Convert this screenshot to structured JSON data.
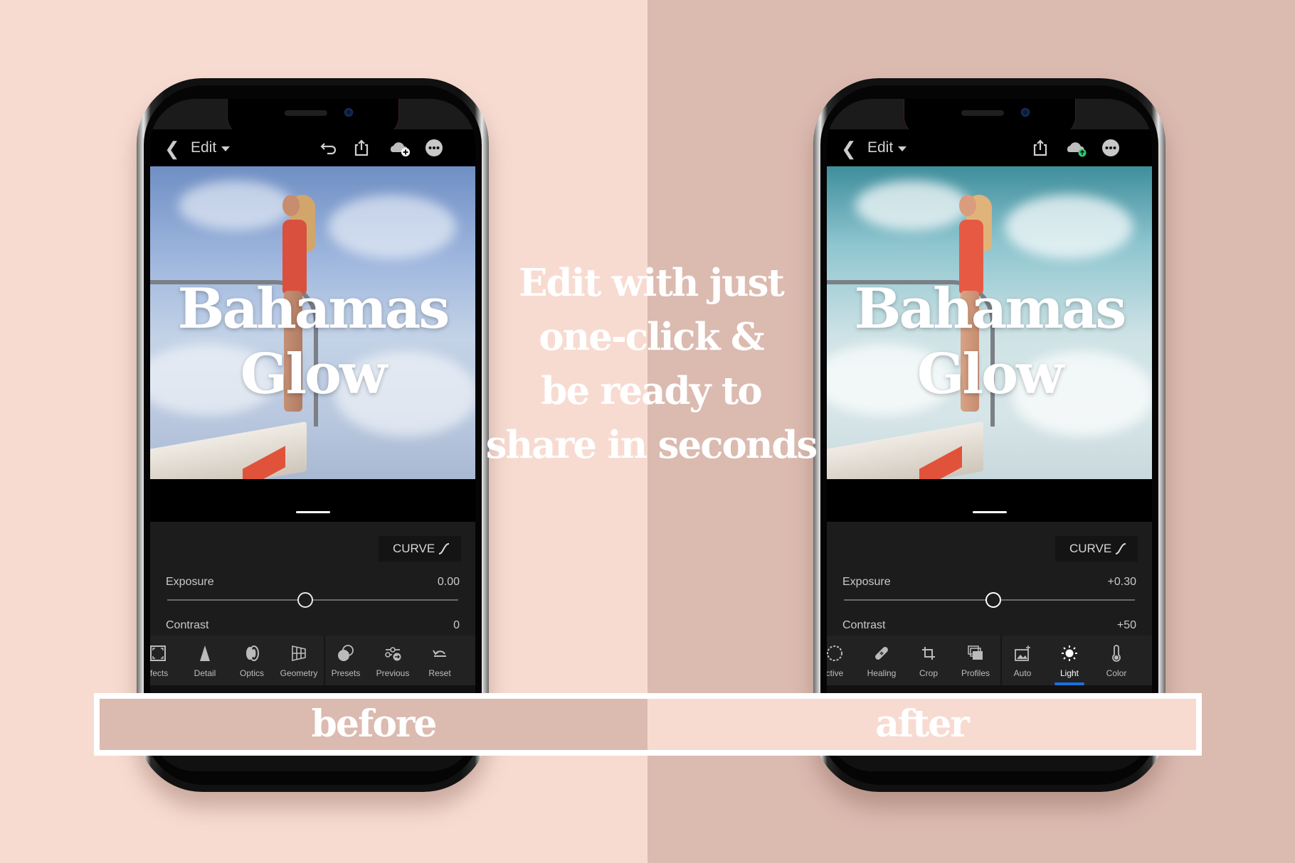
{
  "background": {
    "left_color": "#F7DBD1",
    "right_color": "#DBBAB0"
  },
  "headline": {
    "lines": [
      "Edit with just",
      "one-click &",
      "be ready to",
      "share in seconds"
    ]
  },
  "banner": {
    "before_label": "before",
    "after_label": "after"
  },
  "phones": {
    "before": {
      "topbar": {
        "title": "Edit",
        "icons": [
          "chevron-left-icon",
          "undo-icon",
          "share-icon",
          "cloud-add-icon",
          "more-icon"
        ]
      },
      "photo_title": [
        "Bahamas",
        "Glow"
      ],
      "curve_label": "CURVE",
      "sliders": [
        {
          "label": "Exposure",
          "value": "0.00",
          "position": 0.5
        },
        {
          "label": "Contrast",
          "value": "0"
        }
      ],
      "toolbar": [
        {
          "label": "ffects",
          "icon": "vignette-icon"
        },
        {
          "label": "Detail",
          "icon": "triangle-icon"
        },
        {
          "label": "Optics",
          "icon": "lens-icon"
        },
        {
          "label": "Geometry",
          "icon": "grid-perspective-icon"
        },
        {
          "label": "Presets",
          "icon": "presets-icon"
        },
        {
          "label": "Previous",
          "icon": "previous-icon"
        },
        {
          "label": "Reset",
          "icon": "reset-icon"
        }
      ]
    },
    "after": {
      "topbar": {
        "title": "Edit",
        "icons": [
          "chevron-left-icon",
          "share-icon",
          "cloud-synced-icon",
          "more-icon"
        ]
      },
      "photo_title": [
        "Bahamas",
        "Glow"
      ],
      "curve_label": "CURVE",
      "sliders": [
        {
          "label": "Exposure",
          "value": "+0.30",
          "position": 0.53
        },
        {
          "label": "Contrast",
          "value": "+50"
        }
      ],
      "toolbar": [
        {
          "label": "ctive",
          "icon": "selective-icon"
        },
        {
          "label": "Healing",
          "icon": "bandage-icon"
        },
        {
          "label": "Crop",
          "icon": "crop-icon"
        },
        {
          "label": "Profiles",
          "icon": "profiles-icon"
        },
        {
          "label": "Auto",
          "icon": "auto-icon"
        },
        {
          "label": "Light",
          "icon": "sun-icon",
          "active": true
        },
        {
          "label": "Color",
          "icon": "thermometer-icon"
        }
      ],
      "active_color": "#1B6FE0",
      "sync_color": "#2ECC71"
    }
  }
}
